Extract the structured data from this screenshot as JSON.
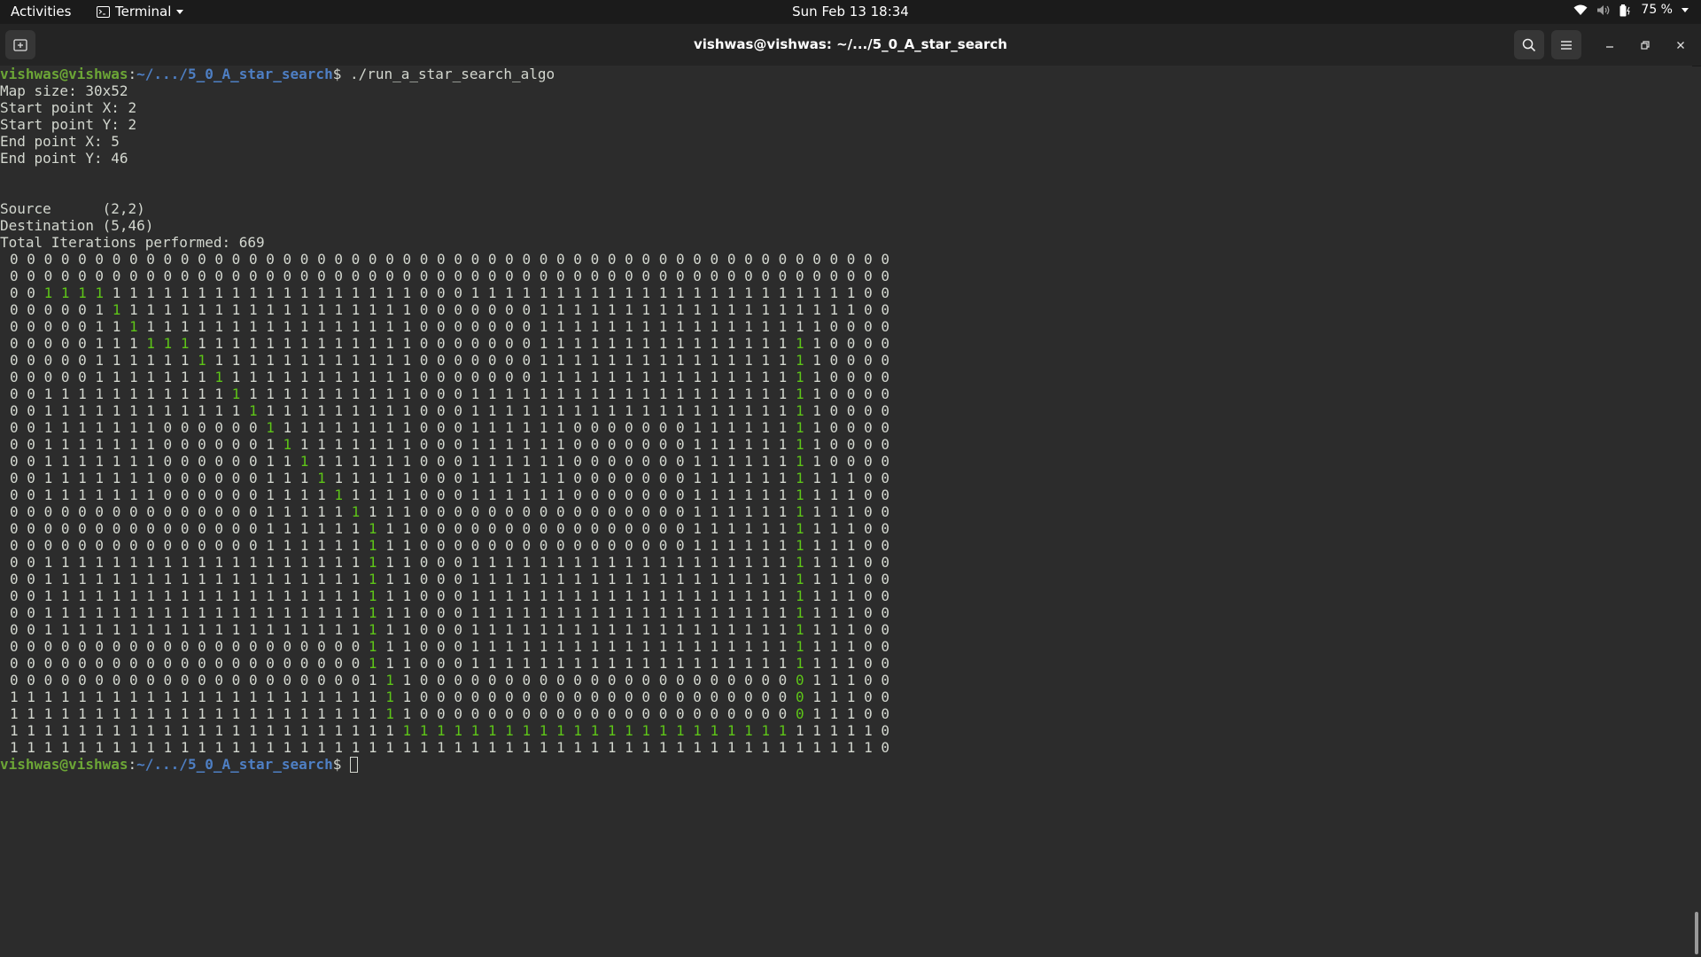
{
  "topbar": {
    "activities": "Activities",
    "app_name": "Terminal",
    "clock": "Sun Feb 13  18:34",
    "battery": "75 %"
  },
  "window": {
    "title": "vishwas@vishwas: ~/.../5_0_A_star_search"
  },
  "terminal": {
    "prompt_user": "vishwas@vishwas",
    "prompt_path": "~/.../5_0_A_star_search",
    "prompt_symbol": "$",
    "command": " ./run_a_star_search_algo",
    "output_lines": [
      "Map size: 30x52",
      "Start point X: 2",
      "Start point Y: 2",
      "End point X: 5",
      "End point Y: 46",
      "",
      "",
      "Source      (2,2)",
      "Destination (5,46)",
      "Total Iterations performed: 669"
    ],
    "grid": [
      "0000000000000000000000000000000000000000000000000000",
      "0000000000000000000000000000000000000000000000000000",
      "0011111111111111111111110001111111111111111111111100",
      "0000011111111111111111110000000111111111111111111100",
      "0000011111111111111111110000000111111111111111110000",
      "0000011111111111111111110000000111111111111111110000",
      "0000011111111111111111110000000111111111111111110000",
      "0000011111111111111111110000000111111111111111110000",
      "0011111111111111111111110001111111111111111111110000",
      "0011111111111111111111110001111111111111111111110000",
      "0011111110000001111111110001111110000000111111110000",
      "0011111110000001111111110001111110000000111111110000",
      "0011111110000001111111110001111110000000111111110000",
      "0011111110000001111111110001111110000000111111111100",
      "0011111110000001111111110001111110000000111111111100",
      "0000000000000001111111110000000000000000111111111100",
      "0000000000000001111111110000000000000000111111111100",
      "0000000000000001111111110000000000000000111111111100",
      "0011111111111111111111110001111111111111111111111100",
      "0011111111111111111111110001111111111111111111111100",
      "0011111111111111111111110001111111111111111111111100",
      "0011111111111111111111110001111111111111111111111100",
      "0011111111111111111111110001111111111111111111111100",
      "0000000000000000000001110001111111111111111111111100",
      "0000000000000000000001110001111111111111111111111100",
      "0000000000000000000001110000000000000000000000011100",
      "1111111111111111111111110000000000000000000000011100",
      "1111111111111111111111110000000000000000000000011100",
      "1111111111111111111111111111111111111111111111111110",
      "1111111111111111111111111111111111111111111111111110"
    ],
    "path": [
      [
        2,
        2
      ],
      [
        2,
        3
      ],
      [
        2,
        4
      ],
      [
        2,
        5
      ],
      [
        3,
        6
      ],
      [
        4,
        7
      ],
      [
        5,
        8
      ],
      [
        5,
        9
      ],
      [
        5,
        10
      ],
      [
        6,
        11
      ],
      [
        7,
        12
      ],
      [
        8,
        13
      ],
      [
        9,
        14
      ],
      [
        10,
        15
      ],
      [
        11,
        16
      ],
      [
        12,
        17
      ],
      [
        13,
        18
      ],
      [
        14,
        19
      ],
      [
        15,
        20
      ],
      [
        16,
        21
      ],
      [
        17,
        21
      ],
      [
        18,
        21
      ],
      [
        19,
        21
      ],
      [
        20,
        21
      ],
      [
        21,
        21
      ],
      [
        22,
        21
      ],
      [
        23,
        21
      ],
      [
        24,
        21
      ],
      [
        25,
        22
      ],
      [
        26,
        22
      ],
      [
        27,
        22
      ],
      [
        28,
        23
      ],
      [
        28,
        24
      ],
      [
        28,
        25
      ],
      [
        28,
        26
      ],
      [
        28,
        27
      ],
      [
        28,
        28
      ],
      [
        28,
        29
      ],
      [
        28,
        30
      ],
      [
        28,
        31
      ],
      [
        28,
        32
      ],
      [
        28,
        33
      ],
      [
        28,
        34
      ],
      [
        28,
        35
      ],
      [
        28,
        36
      ],
      [
        28,
        37
      ],
      [
        28,
        38
      ],
      [
        28,
        39
      ],
      [
        28,
        40
      ],
      [
        28,
        41
      ],
      [
        28,
        42
      ],
      [
        28,
        43
      ],
      [
        28,
        44
      ],
      [
        28,
        45
      ],
      [
        27,
        46
      ],
      [
        26,
        46
      ],
      [
        25,
        46
      ],
      [
        24,
        46
      ],
      [
        23,
        46
      ],
      [
        22,
        46
      ],
      [
        21,
        46
      ],
      [
        20,
        46
      ],
      [
        19,
        46
      ],
      [
        18,
        46
      ],
      [
        17,
        46
      ],
      [
        16,
        46
      ],
      [
        15,
        46
      ],
      [
        14,
        46
      ],
      [
        13,
        46
      ],
      [
        12,
        46
      ],
      [
        11,
        46
      ],
      [
        10,
        46
      ],
      [
        9,
        46
      ],
      [
        8,
        46
      ],
      [
        7,
        46
      ],
      [
        6,
        46
      ],
      [
        5,
        46
      ]
    ],
    "path_color": "#5ec518"
  }
}
